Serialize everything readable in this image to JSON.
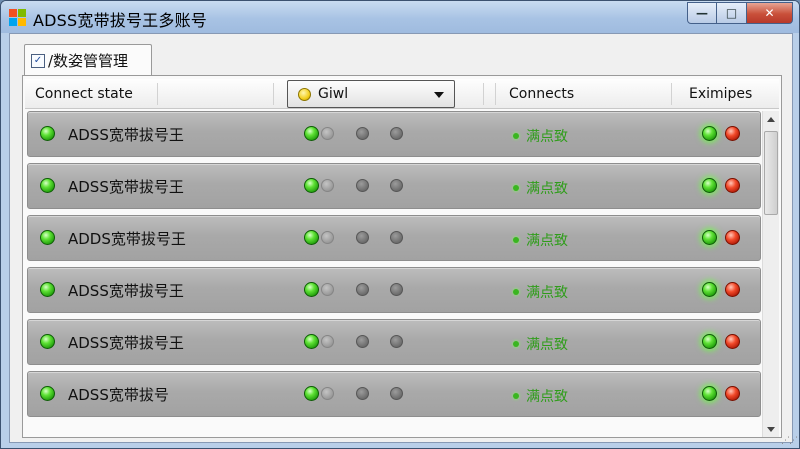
{
  "window": {
    "title": "ADSS宽带拔号王多账号",
    "buttons": {
      "minimize": "—",
      "maximize": "□",
      "close": "✕"
    }
  },
  "tab": {
    "label": "/数姿管管理"
  },
  "header": {
    "connect_state": "Connect state",
    "dropdown_value": "Giwl",
    "connects": "Connects",
    "examples": "Eximipes"
  },
  "rows": [
    {
      "name": "ADSS宽带拔号王",
      "status": "满点致"
    },
    {
      "name": "ADSS宽带拔号王",
      "status": "满点致"
    },
    {
      "name": "ADDS宽带拔号王",
      "status": "满点致"
    },
    {
      "name": "ADSS宽带拔号王",
      "status": "满点致"
    },
    {
      "name": "ADSS宽带拔号王",
      "status": "满点致"
    },
    {
      "name": "ADSS宽带拔号",
      "status": "满点致"
    }
  ],
  "colors": {
    "status_text": "#2f9d1a",
    "led_green": "#3ad21a",
    "led_red": "#d8301a",
    "row_bg": "#a9a9a9"
  }
}
